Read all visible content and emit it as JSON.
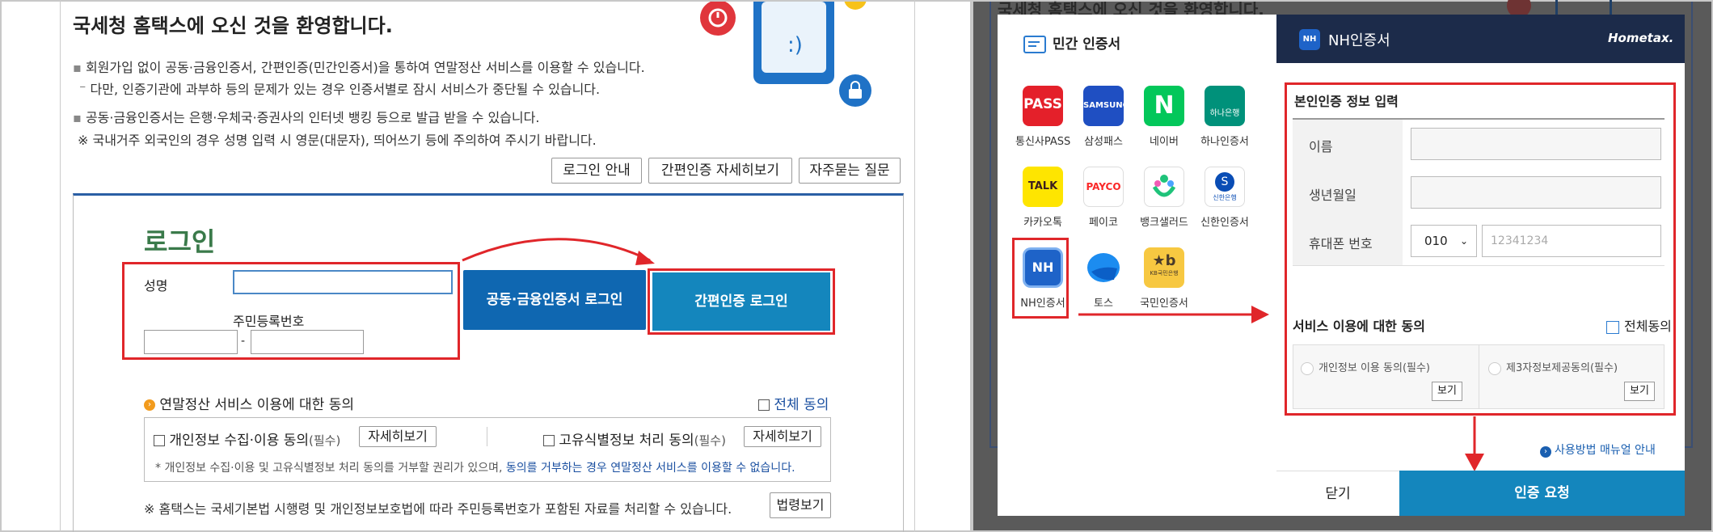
{
  "left": {
    "welcome_title": "국세청 홈택스에 오신 것을 환영합니다.",
    "info_lines": [
      "회원가입 없이 공동·금융인증서, 간편인증(민간인증서)을 통하여 연말정산 서비스를 이용할 수 있습니다.",
      "다만, 인증기관에 과부하 등의 문제가 있는 경우 인증서별로 잠시 서비스가 중단될 수 있습니다.",
      "공동·금융인증서는 은행·우체국·증권사의 인터넷 뱅킹 등으로 발급 받을 수 있습니다.",
      "※ 국내거주 외국인의 경우 성명 입력 시 영문(대문자), 띄어쓰기 등에 주의하여 주시기 바랍니다."
    ],
    "top_buttons": [
      "로그인 안내",
      "간편인증 자세히보기",
      "자주묻는 질문"
    ],
    "login_title": "로그인",
    "name_label": "성명",
    "rrn_label": "주민등록번호",
    "rrn_separator": "-",
    "joint_cert_login": "공동·금융인증서 로그인",
    "simple_auth_login": "간편인증 로그인",
    "consent_title": "연말정산 서비스 이용에 대한 동의",
    "consent_all": "전체 동의",
    "consent_items": [
      {
        "label": "개인정보 수집·이용 동의",
        "req": "(필수)",
        "btn": "자세히보기"
      },
      {
        "label": "고유식별정보 처리 동의",
        "req": "(필수)",
        "btn": "자세히보기"
      }
    ],
    "notice_prefix": "* 개인정보 수집·이용 및 고유식별정보 처리 동의를 거부할 권리가 있으며, ",
    "notice_link": "동의를 거부하는 경우 연말정산 서비스를 이용할 수 없습니다.",
    "law_notice": "※ 홈택스는 국세기본법 시행령 및 개인정보보호법에 따라 주민등록번호가 포함된 자료를 처리할 수 있습니다.",
    "law_button": "법령보기"
  },
  "right": {
    "bg_title": "국세청 홈택스에 오신 것을 환영합니다.",
    "private_cert_title": "민간 인증서",
    "providers": [
      {
        "name": "통신사PASS",
        "logo": "PASS",
        "color": "#e4202a"
      },
      {
        "name": "삼성패스",
        "logo": "SAMSUNG Pass",
        "color": "#1f4fc2"
      },
      {
        "name": "네이버",
        "logo": "N",
        "color": "#03c75a"
      },
      {
        "name": "하나인증서",
        "logo": "하나은행",
        "color": "#00917a"
      },
      {
        "name": "카카오톡",
        "logo": "TALK",
        "color": "#fee500"
      },
      {
        "name": "페이코",
        "logo": "PAYCO",
        "color": "#fa2828"
      },
      {
        "name": "뱅크샐러드",
        "logo": "banksalad",
        "color": "#ffffff"
      },
      {
        "name": "신한인증서",
        "logo": "신한은행",
        "color": "#ffffff"
      },
      {
        "name": "NH인증서",
        "logo": "NH",
        "color": "#1e63c8"
      },
      {
        "name": "토스",
        "logo": "toss",
        "color": "#ffffff"
      },
      {
        "name": "국민인증서",
        "logo": "KB국민은행",
        "color": "#f7c841"
      }
    ],
    "nh_header": "NH인증서",
    "hometax_logo": "Hometax.",
    "identity_title": "본인인증 정보 입력",
    "field_name": "이름",
    "field_birth": "생년월일",
    "field_phone": "휴대폰 번호",
    "phone_prefix": "010",
    "phone_placeholder": "12341234",
    "service_consent_title": "서비스 이용에 대한 동의",
    "all_consent": "전체동의",
    "consent_a": "개인정보 이용 동의(필수)",
    "consent_b": "제3자정보제공동의(필수)",
    "view_btn": "보기",
    "manual_link": "사용방법 매뉴얼 안내",
    "close_btn": "닫기",
    "auth_request_btn": "인증 요청"
  },
  "colors": {
    "accent_blue": "#0f67b1",
    "simple_blue": "#1486bd",
    "red": "#e0262a",
    "header_navy": "#1c2b4a",
    "login_green": "#3a7a4a"
  }
}
